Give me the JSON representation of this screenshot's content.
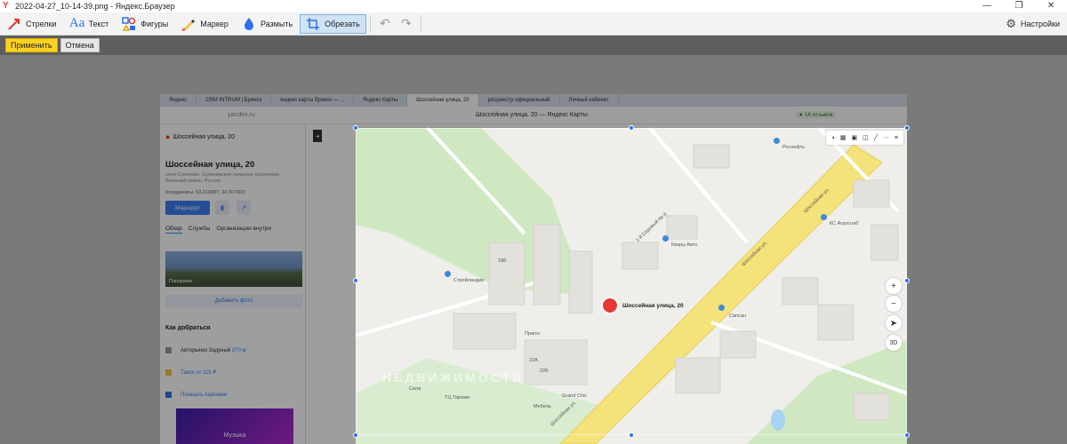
{
  "window": {
    "title": "2022-04-27_10-14-39.png - Яндекс.Браузер",
    "min": "—",
    "max": "❐",
    "close": "✕"
  },
  "toolbar": {
    "arrows": "Стрелки",
    "text": "Текст",
    "shapes": "Фигуры",
    "marker": "Маркер",
    "blur": "Размыть",
    "crop": "Обрезать",
    "settings": "Настройки"
  },
  "actions": {
    "apply": "Применить",
    "cancel": "Отмена"
  },
  "shot": {
    "tabs": [
      "Яндекс",
      "CRM INTRUM | Брянск",
      "яндекс карты брянск — ...",
      "Яндекс Карты",
      "Шоссейная улица, 20",
      "росреестр официальный",
      "Личный кабинет"
    ],
    "url": "yandex.ru",
    "page_title": "Шоссейная улица, 20 — Яндекс Карты",
    "reviews": "★ 1K отзывов",
    "search_value": "Шоссейная улица, 20",
    "place_title": "Шоссейная улица, 20",
    "place_sub": "село Супонево, Супоневское сельское поселение, Брянский район, Россия",
    "coords": "Координаты: 53.213887, 34.307603",
    "route": "Маршрут",
    "tabs_place": [
      "Обзор",
      "Службы",
      "Организации внутри"
    ],
    "photo_label": "Панорама",
    "add_photo": "Добавить фото",
    "how_to_get": "Как добраться",
    "transit": "Авторынок Задуный",
    "transit_dist": "370 м",
    "taxi": "Такси от 115 ₽",
    "parking": "Показать парковки",
    "promo": "Музыка",
    "marker_label": "Шоссейная улица, 20",
    "map_labels": [
      "Шоссейная ул.",
      "Шоссейная ул.",
      "Шоссейная ул.",
      "1-й Садовый пр-д",
      "Роснефть",
      "Кварц-Авто",
      "Стройландия",
      "Прагос",
      "Grand Chic",
      "Мебель",
      "Сила",
      "ТЦ Тиражи",
      "КС Агроснаб",
      "Сапсан",
      "18Б",
      "22А",
      "22Б"
    ],
    "watermark": "НЕДВИЖИМОСТИ"
  },
  "icons": {
    "arrow": "arrow-icon",
    "text": "text-icon",
    "shapes": "shapes-icon",
    "marker": "marker-icon",
    "blur": "drop-icon",
    "crop": "crop-icon",
    "undo": "undo-icon",
    "redo": "redo-icon",
    "settings": "gear-icon"
  },
  "colors": {
    "accent": "#2e6ff0",
    "apply": "#ffd21f",
    "marker": "#e53935",
    "road": "#f4e27a"
  }
}
